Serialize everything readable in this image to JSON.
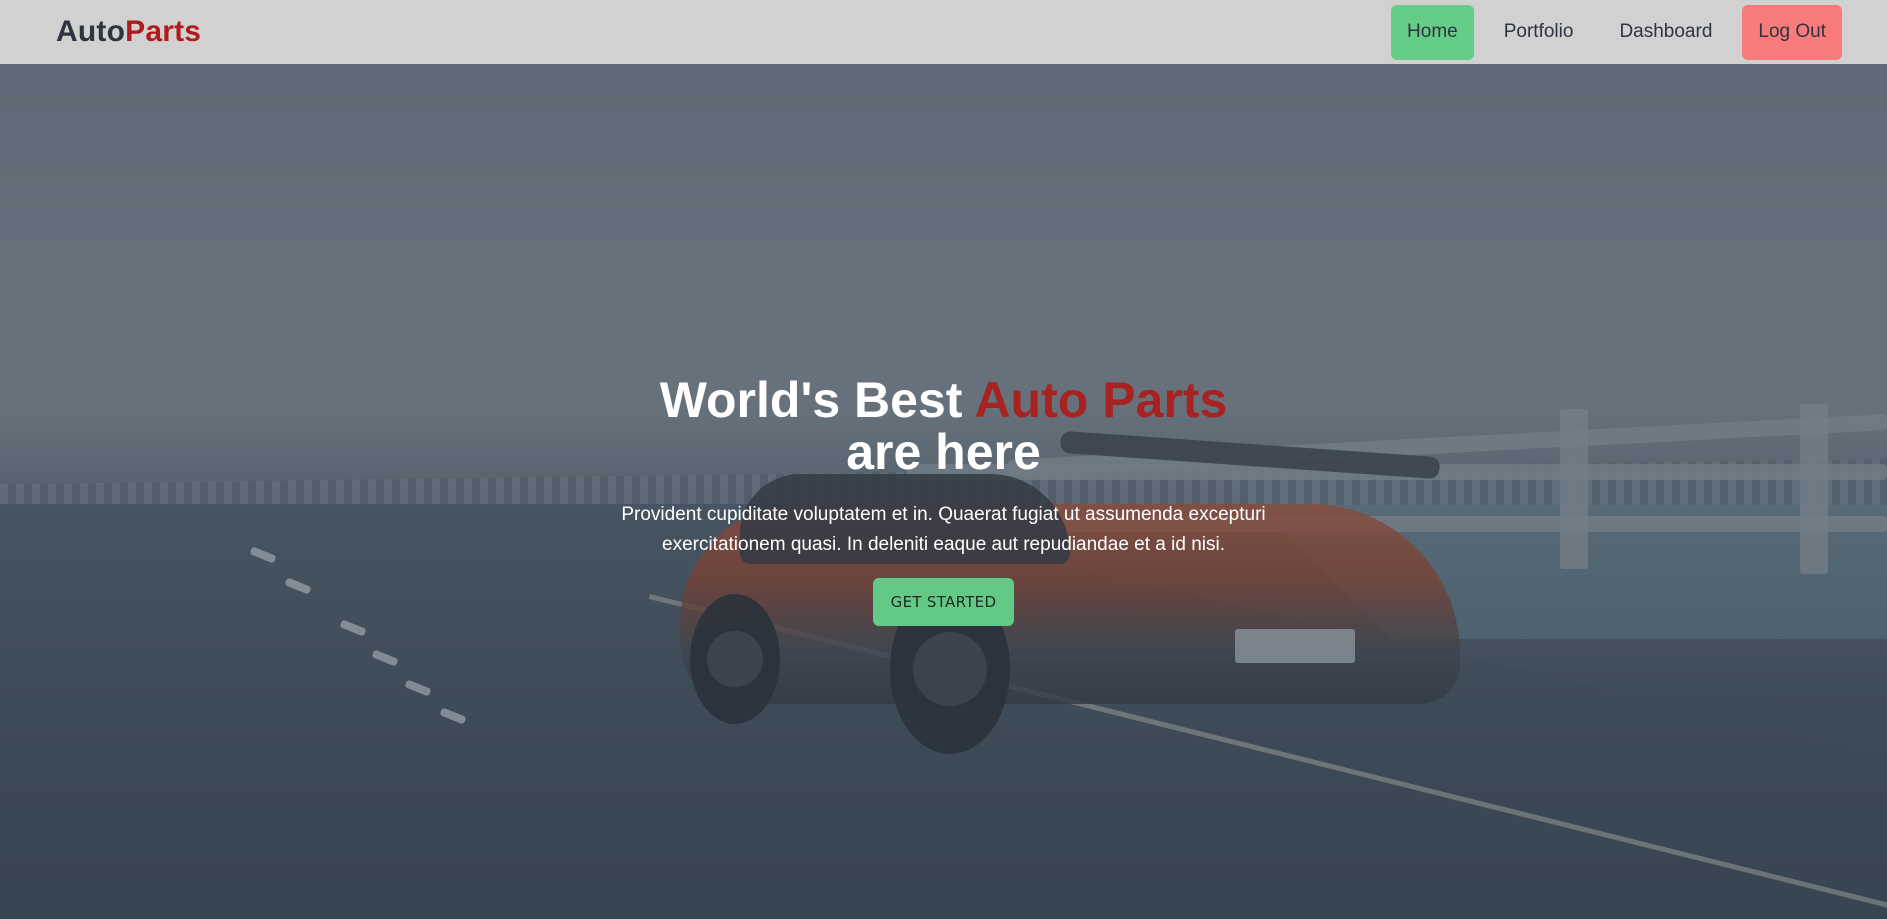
{
  "brand": {
    "part1": "Auto",
    "part2": "Parts"
  },
  "nav": {
    "home": "Home",
    "portfolio": "Portfolio",
    "dashboard": "Dashboard",
    "logout": "Log Out"
  },
  "hero": {
    "title_part1": "World's Best ",
    "title_accent": "Auto Parts",
    "title_part2": "are here",
    "description": "Provident cupiditate voluptatem et in. Quaerat fugiat ut assumenda excepturi exercitationem quasi. In deleniti eaque aut repudiandae et a id nisi.",
    "cta_label": "GET STARTED",
    "image": "sports-car-on-bridge"
  },
  "colors": {
    "nav_bg": "#d1d1d1",
    "brand_dark": "#2f3440",
    "brand_accent": "#b01c1c",
    "home_button": "#66cd88",
    "logout_button": "#f77b7b",
    "cta_button": "#63c986"
  }
}
